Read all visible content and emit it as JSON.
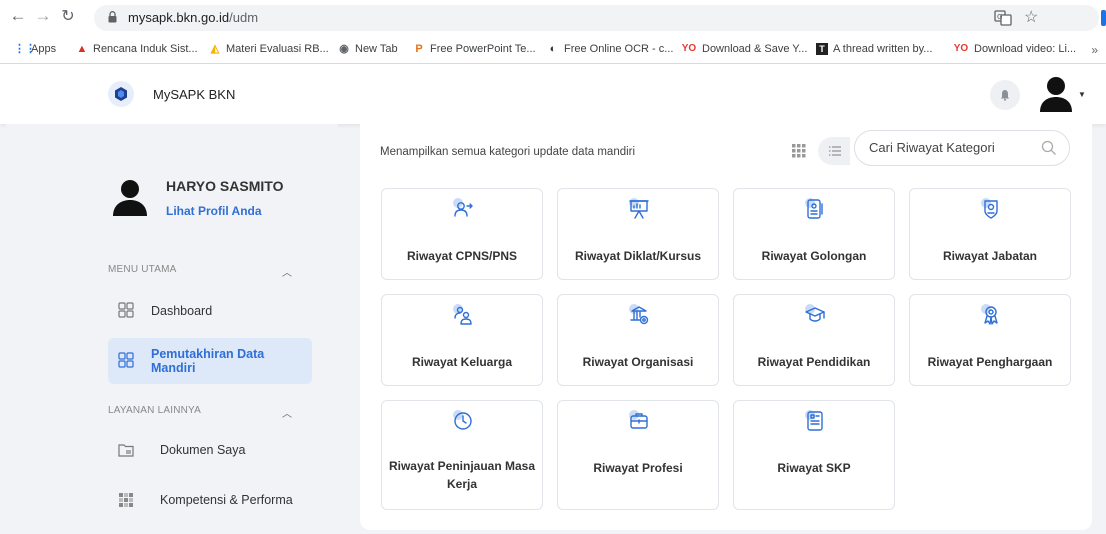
{
  "browser": {
    "url_domain": "mysapk.bkn.go.id",
    "url_path": "/udm",
    "bookmarks": [
      {
        "label": "Apps",
        "icon": "apps-grid-icon",
        "color": "#1a73e8"
      },
      {
        "label": "Rencana Induk Sist...",
        "icon": "red-triangle-icon",
        "color": "#d93025"
      },
      {
        "label": "Materi Evaluasi RB...",
        "icon": "drive-icon",
        "color": "#f4b400"
      },
      {
        "label": "New Tab",
        "icon": "new-tab-icon",
        "color": "#5f6368"
      },
      {
        "label": "Free PowerPoint Te...",
        "icon": "p-icon",
        "color": "#e8711a"
      },
      {
        "label": "Free Online OCR - c...",
        "icon": "ocr-icon",
        "color": "#333333"
      },
      {
        "label": "Download & Save Y...",
        "icon": "yo-icon",
        "color": "#e53935"
      },
      {
        "label": "A thread written by...",
        "icon": "t-icon",
        "color": "#222222"
      },
      {
        "label": "Download video: Li...",
        "icon": "yo-icon",
        "color": "#e53935"
      }
    ],
    "more": "»"
  },
  "header": {
    "app_title": "MySAPK BKN",
    "brand_color": "#2f6fd6"
  },
  "sidebar": {
    "profile_name": "HARYO SASMITO",
    "profile_link": "Lihat Profil Anda",
    "sections": [
      {
        "title": "MENU UTAMA",
        "items": [
          {
            "label": "Dashboard",
            "icon": "dashboard-icon",
            "active": false
          },
          {
            "label": "Pemutakhiran Data Mandiri",
            "icon": "dashboard-icon",
            "active": true
          }
        ]
      },
      {
        "title": "LAYANAN LAINNYA",
        "items": [
          {
            "label": "Dokumen Saya",
            "icon": "folder-icon",
            "active": false
          },
          {
            "label": "Kompetensi & Performa",
            "icon": "grid-blocks-icon",
            "active": false
          }
        ]
      }
    ]
  },
  "main": {
    "subtitle": "Menampilkan semua kategori update data mandiri",
    "search_placeholder": "Cari Riwayat Kategori",
    "cards": [
      {
        "label": "Riwayat CPNS/PNS",
        "icon": "person-swap-icon"
      },
      {
        "label": "Riwayat Diklat/Kursus",
        "icon": "presentation-icon"
      },
      {
        "label": "Riwayat Golongan",
        "icon": "id-card-icon"
      },
      {
        "label": "Riwayat Jabatan",
        "icon": "badge-icon"
      },
      {
        "label": "Riwayat Keluarga",
        "icon": "family-icon"
      },
      {
        "label": "Riwayat Organisasi",
        "icon": "organization-icon"
      },
      {
        "label": "Riwayat Pendidikan",
        "icon": "graduation-cap-icon"
      },
      {
        "label": "Riwayat Penghargaan",
        "icon": "award-icon"
      },
      {
        "label": "Riwayat Peninjauan Masa Kerja",
        "icon": "clock-icon"
      },
      {
        "label": "Riwayat Profesi",
        "icon": "briefcase-icon"
      },
      {
        "label": "Riwayat SKP",
        "icon": "document-icon"
      }
    ]
  }
}
